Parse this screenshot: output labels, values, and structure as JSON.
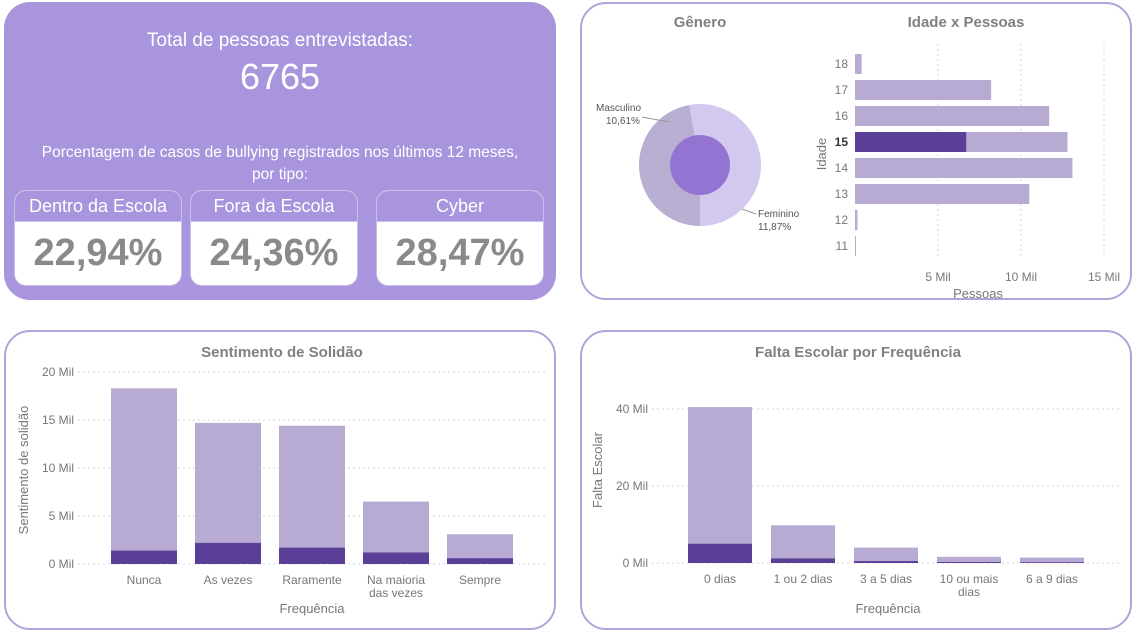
{
  "kpi": {
    "title": "Total de pessoas entrevistadas:",
    "total": "6765",
    "subtitle_line1": "Porcentagem de casos de bullying registrados nos últimos 12 meses,",
    "subtitle_line2": "por tipo:",
    "tiles": [
      {
        "label": "Dentro da Escola",
        "value": "22,94%"
      },
      {
        "label": "Fora da Escola",
        "value": "24,36%"
      },
      {
        "label": "Cyber",
        "value": "28,47%"
      }
    ]
  },
  "colors": {
    "panel": "#a895dd",
    "bar_light": "#b8abd3",
    "bar_dark": "#5b3e97",
    "pie_outer_dark": "#b8afd2",
    "pie_outer_light": "#d3c8ee",
    "pie_inner": "#9474d3",
    "axis_text": "#777777",
    "title_text": "#808080"
  },
  "chart_data": [
    {
      "type": "pie",
      "title": "Gênero",
      "slices": [
        {
          "label": "Masculino",
          "value_label": "10,61%",
          "value": 10.61
        },
        {
          "label": "Feminino",
          "value_label": "11,87%",
          "value": 11.87
        }
      ]
    },
    {
      "type": "bar",
      "orientation": "horizontal",
      "title": "Idade x Pessoas",
      "xlabel": "Pessoas",
      "ylabel": "Idade",
      "categories": [
        "18",
        "17",
        "16",
        "15",
        "14",
        "13",
        "12",
        "11"
      ],
      "highlighted_category": "15",
      "xlim": [
        0,
        15000
      ],
      "xticks": [
        "5 Mil",
        "10 Mil",
        "15 Mil"
      ],
      "series": [
        {
          "name": "",
          "values": [
            400,
            8200,
            11700,
            12800,
            13100,
            10500,
            150,
            50
          ]
        },
        {
          "name": "",
          "values": [
            0,
            0,
            0,
            6700,
            0,
            0,
            0,
            0
          ]
        }
      ],
      "grid": true
    },
    {
      "type": "bar",
      "title": "Sentimento de Solidão",
      "xlabel": "Frequência",
      "ylabel": "Sentimento de solidão",
      "categories": [
        [
          "Nunca"
        ],
        [
          "As vezes"
        ],
        [
          "Raramente"
        ],
        [
          "Na maioria",
          "das vezes"
        ],
        [
          "Sempre"
        ]
      ],
      "ylim": [
        0,
        20000
      ],
      "yticks": [
        "0 Mil",
        "5 Mil",
        "10 Mil",
        "15 Mil",
        "20 Mil"
      ],
      "series": [
        {
          "name": "",
          "values": [
            18300,
            14700,
            14400,
            6500,
            3100
          ]
        },
        {
          "name": "",
          "values": [
            1400,
            2200,
            1700,
            1200,
            600
          ]
        }
      ],
      "stacked_overlay": true,
      "grid": true
    },
    {
      "type": "bar",
      "title": "Falta Escolar por Frequência",
      "xlabel": "Frequência",
      "ylabel": "Falta Escolar",
      "categories": [
        [
          "0 dias"
        ],
        [
          "1 ou 2 dias"
        ],
        [
          "3 a 5 dias"
        ],
        [
          "10 ou mais",
          "dias"
        ],
        [
          "6 a 9 dias"
        ]
      ],
      "ylim": [
        0,
        40000
      ],
      "yticks": [
        "0 Mil",
        "20 Mil",
        "40 Mil"
      ],
      "series": [
        {
          "name": "",
          "values": [
            40500,
            9800,
            4000,
            1600,
            1400
          ]
        },
        {
          "name": "",
          "values": [
            5000,
            1200,
            500,
            250,
            200
          ]
        }
      ],
      "stacked_overlay": true,
      "grid": true
    }
  ]
}
